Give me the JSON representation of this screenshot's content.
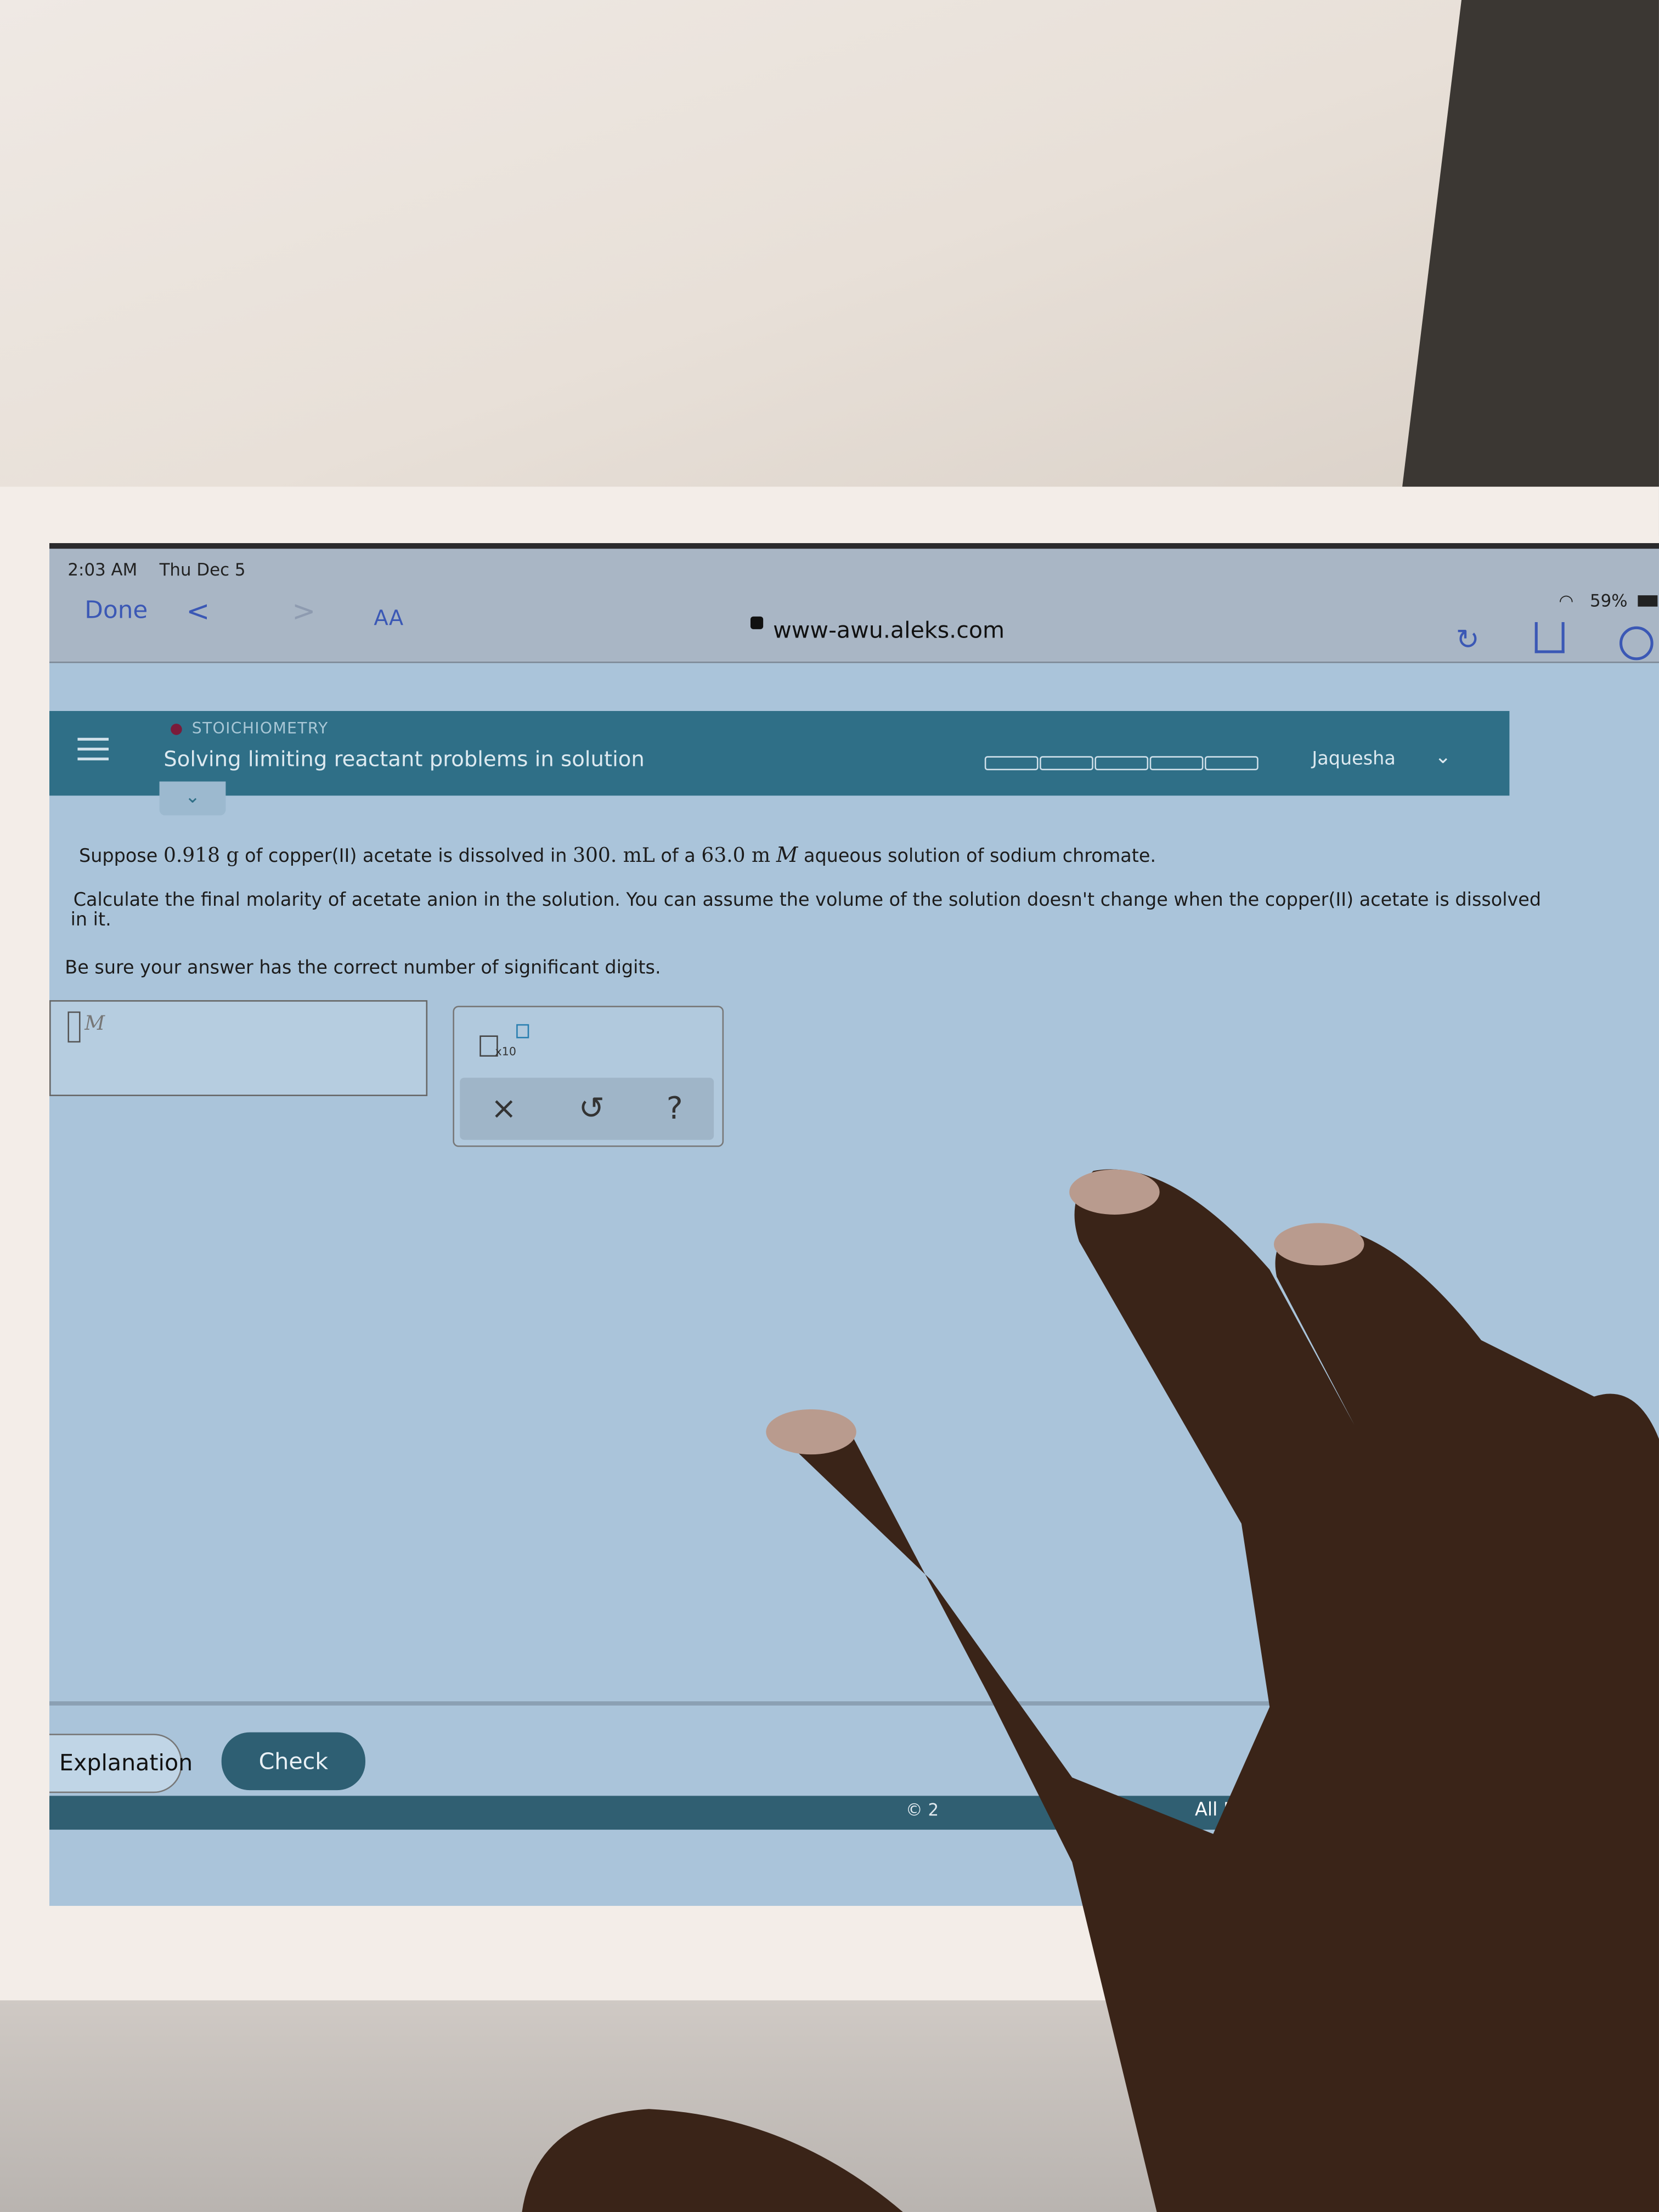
{
  "status_bar": {
    "time": "2:03 AM",
    "date": "Thu Dec 5",
    "battery": "59%"
  },
  "browser": {
    "done_label": "Done",
    "back_icon": "chevron-left-icon",
    "forward_icon": "chevron-right-icon",
    "text_size_label": "AA",
    "url": "www-awu.aleks.com",
    "icons": [
      "lock-icon",
      "reload-icon",
      "share-icon",
      "compass-icon",
      "wifi-icon",
      "battery-icon"
    ]
  },
  "aleks_header": {
    "topic": "STOICHIOMETRY",
    "title": "Solving limiting reactant problems in solution",
    "progress_segments": 5,
    "progress_filled": 0,
    "user": "Jaquesha"
  },
  "question": {
    "line1_a": "Suppose",
    "mass": "0.918 g",
    "line1_b": "of copper(II) acetate is dissolved in",
    "volume": "300. mL",
    "line1_c": "of a",
    "conc": "63.0 m",
    "unit_M": "M",
    "line1_d": "aqueous solution of sodium chromate.",
    "line2": "Calculate the final molarity of acetate anion in the solution. You can assume the volume of the solution doesn't change when the copper(II) acetate is dissolved",
    "line2_cont": "in it.",
    "line3": "Be sure your answer has the correct number of significant digits."
  },
  "answer": {
    "value": "",
    "unit": "M"
  },
  "tools": {
    "sci_notation_label": "x10",
    "clear": "×",
    "undo": "↺",
    "help": "?"
  },
  "buttons": {
    "explanation": "Explanation",
    "check": "Check"
  },
  "footer": {
    "copyright": "© 2",
    "rights": "All Right"
  },
  "colors": {
    "header": "#2f6f87",
    "check_button": "#2e5f73",
    "link": "#3b58b5",
    "content_bg": "#aac4da"
  }
}
